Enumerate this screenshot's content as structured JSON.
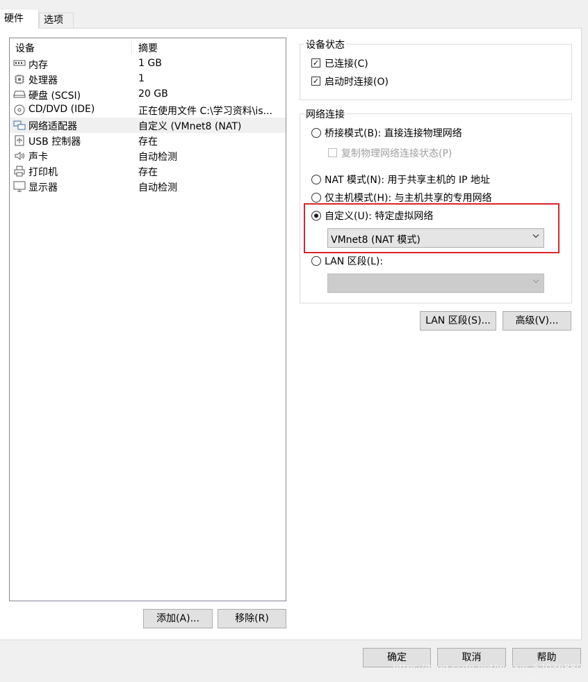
{
  "tabs": [
    {
      "label": "硬件"
    },
    {
      "label": "选项"
    }
  ],
  "devices": {
    "col_device": "设备",
    "col_summary": "摘要",
    "rows": [
      {
        "icon": "memory-icon",
        "name": "内存",
        "summary": "1 GB"
      },
      {
        "icon": "cpu-icon",
        "name": "处理器",
        "summary": "1"
      },
      {
        "icon": "harddisk-icon",
        "name": "硬盘 (SCSI)",
        "summary": "20 GB"
      },
      {
        "icon": "cd-icon",
        "name": "CD/DVD (IDE)",
        "summary": "正在使用文件 C:\\学习资料\\is..."
      },
      {
        "icon": "network-icon",
        "name": "网络适配器",
        "summary": "自定义 (VMnet8 (NAT)"
      },
      {
        "icon": "usb-icon",
        "name": "USB 控制器",
        "summary": "存在"
      },
      {
        "icon": "speaker-icon",
        "name": "声卡",
        "summary": "自动检测"
      },
      {
        "icon": "printer-icon",
        "name": "打印机",
        "summary": "存在"
      },
      {
        "icon": "monitor-icon",
        "name": "显示器",
        "summary": "自动检测"
      }
    ],
    "selected_index": 4,
    "add_label": "添加(A)...",
    "remove_label": "移除(R)"
  },
  "device_status": {
    "title": "设备状态",
    "connected_label": "已连接(C)",
    "connected_checked": true,
    "connect_on_start_label": "启动时连接(O)",
    "connect_on_start_checked": true
  },
  "network": {
    "title": "网络连接",
    "bridged_label": "桥接模式(B): 直接连接物理网络",
    "replicate_label": "复制物理网络连接状态(P)",
    "nat_label": "NAT 模式(N): 用于共享主机的 IP 地址",
    "hostonly_label": "仅主机模式(H): 与主机共享的专用网络",
    "custom_label": "自定义(U): 特定虚拟网络",
    "custom_value": "VMnet8 (NAT 模式)",
    "lan_label": "LAN 区段(L):",
    "lan_value": "",
    "selected": "custom"
  },
  "lan_segments_button": "LAN 区段(S)...",
  "advanced_button": "高级(V)...",
  "footer": {
    "ok": "确定",
    "cancel": "取消",
    "help": "帮助"
  },
  "watermark": "https://blog.csdn.net/weixin_52036880",
  "colors": {
    "highlight_border": "#d7262b",
    "window_bg": "#f0f0f0",
    "panel_bg": "#ffffff"
  }
}
